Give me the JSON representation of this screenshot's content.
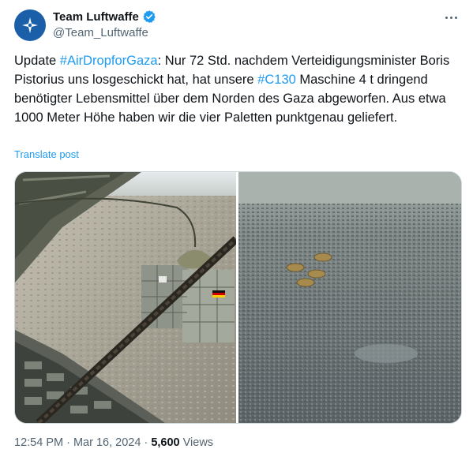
{
  "author": {
    "display_name": "Team Luftwaffe",
    "handle": "@Team_Luftwaffe",
    "avatar_icon": "luftwaffe-logo-icon",
    "verified_icon": "verified-badge-icon"
  },
  "post": {
    "text_parts": {
      "p1": "Update ",
      "h1": "#AirDropforGaza",
      "p2": ": Nur 72 Std.  nachdem Verteidigungsminister Boris Pistorius uns losgeschickt hat, hat unsere ",
      "h2": "#C130",
      "p3": " Maschine 4 t dringend benötigter Lebensmittel über dem Norden des Gaza abgeworfen. Aus etwa 1000 Meter Höhe haben wir die vier Paletten punktgenau geliefert."
    },
    "translate_label": "Translate post",
    "images": [
      {
        "name": "cargo-door-pallets-photo"
      },
      {
        "name": "parachutes-over-city-photo"
      }
    ]
  },
  "meta": {
    "time": "12:54 PM",
    "separator": " · ",
    "date": "Mar 16, 2024",
    "views_count": "5,600",
    "views_label": " Views"
  },
  "colors": {
    "link": "#1d9bf0",
    "text": "#0f1419",
    "secondary": "#536471",
    "verified": "#1d9bf0"
  }
}
